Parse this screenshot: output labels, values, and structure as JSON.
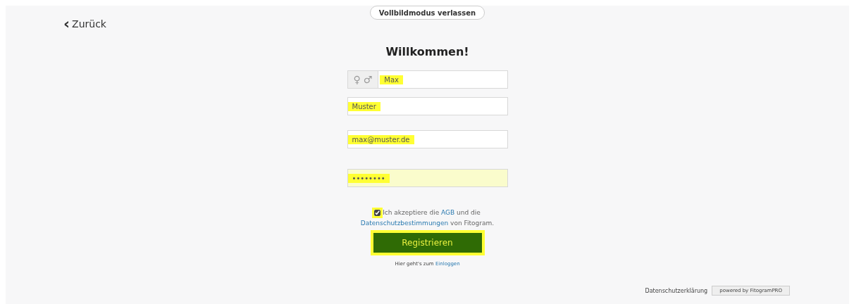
{
  "exit_fullscreen": "Vollbildmodus verlassen",
  "back": {
    "icon": "‹",
    "label": "Zurück"
  },
  "title": "Willkommen!",
  "fields": [
    {
      "kind": "name",
      "value": "Max",
      "gender_symbols": [
        "♀",
        "♂"
      ],
      "highlighted": true,
      "autofilled": false
    },
    {
      "kind": "text",
      "value": "Muster",
      "highlighted": true,
      "autofilled": false
    },
    {
      "kind": "text",
      "value": "max@muster.de",
      "highlighted": true,
      "autofilled": false
    },
    {
      "kind": "password",
      "value": "••••••••",
      "highlighted": true,
      "autofilled": true
    }
  ],
  "consent": {
    "checked": true,
    "highlighted": true,
    "parts": [
      {
        "kind": "text",
        "text": "Ich akzeptiere die "
      },
      {
        "kind": "link",
        "text": "AGB"
      },
      {
        "kind": "text",
        "text": " und die"
      },
      {
        "kind": "break"
      },
      {
        "kind": "link",
        "text": "Datenschutzbestimmungen"
      },
      {
        "kind": "text",
        "text": " von Fitogram."
      }
    ]
  },
  "submit": {
    "label": "Registrieren",
    "highlighted": true
  },
  "login_hint": {
    "text": "Hier geht's zum ",
    "link": "Einloggen"
  },
  "footer": {
    "privacy": "Datenschutzerklärung",
    "powered_by": "powered by FitogramPRO"
  }
}
